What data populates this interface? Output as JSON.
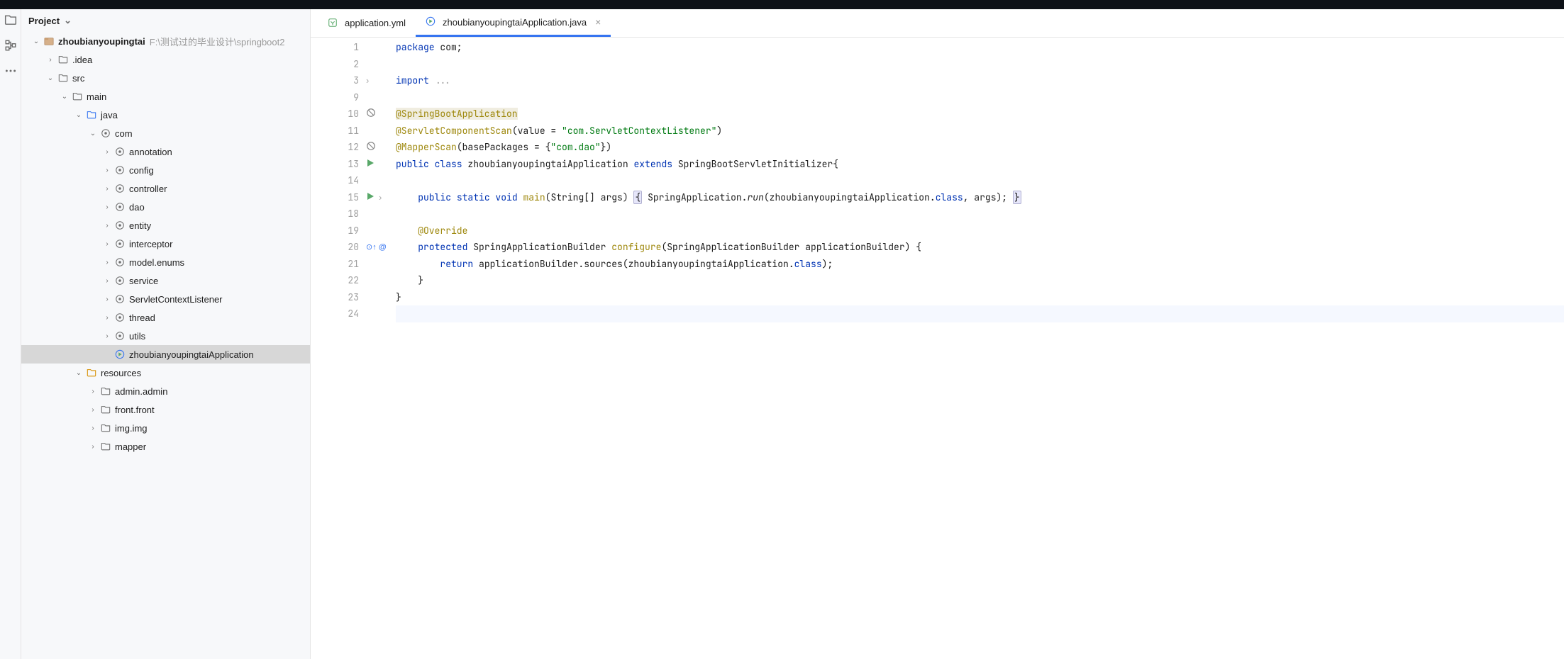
{
  "sidebar": {
    "title": "Project",
    "tree": [
      {
        "indent": 0,
        "arrow": "down",
        "icon": "module",
        "label": "zhoubianyoupingtai",
        "bold": true,
        "hint": "F:\\测试过的毕业设计\\springboot2"
      },
      {
        "indent": 1,
        "arrow": "right",
        "icon": "folder",
        "label": ".idea"
      },
      {
        "indent": 1,
        "arrow": "down",
        "icon": "folder",
        "label": "src"
      },
      {
        "indent": 2,
        "arrow": "down",
        "icon": "folder",
        "label": "main"
      },
      {
        "indent": 3,
        "arrow": "down",
        "icon": "folder-src",
        "label": "java"
      },
      {
        "indent": 4,
        "arrow": "down",
        "icon": "package",
        "label": "com"
      },
      {
        "indent": 5,
        "arrow": "right",
        "icon": "package",
        "label": "annotation"
      },
      {
        "indent": 5,
        "arrow": "right",
        "icon": "package",
        "label": "config"
      },
      {
        "indent": 5,
        "arrow": "right",
        "icon": "package",
        "label": "controller"
      },
      {
        "indent": 5,
        "arrow": "right",
        "icon": "package",
        "label": "dao"
      },
      {
        "indent": 5,
        "arrow": "right",
        "icon": "package",
        "label": "entity"
      },
      {
        "indent": 5,
        "arrow": "right",
        "icon": "package",
        "label": "interceptor"
      },
      {
        "indent": 5,
        "arrow": "right",
        "icon": "package",
        "label": "model.enums"
      },
      {
        "indent": 5,
        "arrow": "right",
        "icon": "package",
        "label": "service"
      },
      {
        "indent": 5,
        "arrow": "right",
        "icon": "package",
        "label": "ServletContextListener"
      },
      {
        "indent": 5,
        "arrow": "right",
        "icon": "package",
        "label": "thread"
      },
      {
        "indent": 5,
        "arrow": "right",
        "icon": "package",
        "label": "utils"
      },
      {
        "indent": 5,
        "arrow": "",
        "icon": "java-run",
        "label": "zhoubianyoupingtaiApplication",
        "selected": true
      },
      {
        "indent": 3,
        "arrow": "down",
        "icon": "folder-res",
        "label": "resources"
      },
      {
        "indent": 4,
        "arrow": "right",
        "icon": "folder",
        "label": "admin.admin"
      },
      {
        "indent": 4,
        "arrow": "right",
        "icon": "folder",
        "label": "front.front"
      },
      {
        "indent": 4,
        "arrow": "right",
        "icon": "folder",
        "label": "img.img"
      },
      {
        "indent": 4,
        "arrow": "right",
        "icon": "folder",
        "label": "mapper"
      }
    ]
  },
  "tabs": [
    {
      "icon": "yaml",
      "label": "application.yml",
      "active": false
    },
    {
      "icon": "java-run",
      "label": "zhoubianyoupingtaiApplication.java",
      "active": true
    }
  ],
  "code": {
    "line_numbers": [
      "1",
      "2",
      "3",
      "9",
      "10",
      "11",
      "12",
      "13",
      "14",
      "15",
      "18",
      "19",
      "20",
      "21",
      "22",
      "23",
      "24"
    ],
    "marks": {
      "10": "forbid",
      "12": "forbid",
      "13": "run",
      "15": "run-fold",
      "20": "override",
      "3": "fold"
    },
    "tokens": {
      "l1_package": "package",
      "l1_pkg": " com;",
      "l3_import": "import",
      "l3_dots": " ...",
      "l10": "@SpringBootApplication",
      "l11_ann": "@ServletComponentScan",
      "l11_rest1": "(value = ",
      "l11_str": "\"com.ServletContextListener\"",
      "l11_rest2": ")",
      "l12_ann": "@MapperScan",
      "l12_rest1": "(basePackages = {",
      "l12_str": "\"com.dao\"",
      "l12_rest2": "})",
      "l13_public": "public ",
      "l13_class": "class ",
      "l13_name": "zhoubianyoupingtaiApplication ",
      "l13_extends": "extends ",
      "l13_parent": "SpringBootServletInitializer{",
      "l15_indent": "    ",
      "l15_public": "public ",
      "l15_static": "static ",
      "l15_void": "void ",
      "l15_main": "main",
      "l15_args": "(String[] args) ",
      "l15_brace1": "{",
      "l15_body1": " SpringApplication.",
      "l15_run": "run",
      "l15_body2": "(zhoubianyoupingtaiApplication.",
      "l15_classkw": "class",
      "l15_body3": ", args); ",
      "l15_brace2": "}",
      "l19_indent": "    ",
      "l19": "@Override",
      "l20_indent": "    ",
      "l20_protected": "protected ",
      "l20_ret": "SpringApplicationBuilder ",
      "l20_fn": "configure",
      "l20_args": "(SpringApplicationBuilder applicationBuilder) {",
      "l21_indent": "        ",
      "l21_return": "return ",
      "l21_body": "applicationBuilder.sources(zhoubianyoupingtaiApplication.",
      "l21_classkw": "class",
      "l21_end": ");",
      "l22": "    }",
      "l23": "}"
    }
  }
}
